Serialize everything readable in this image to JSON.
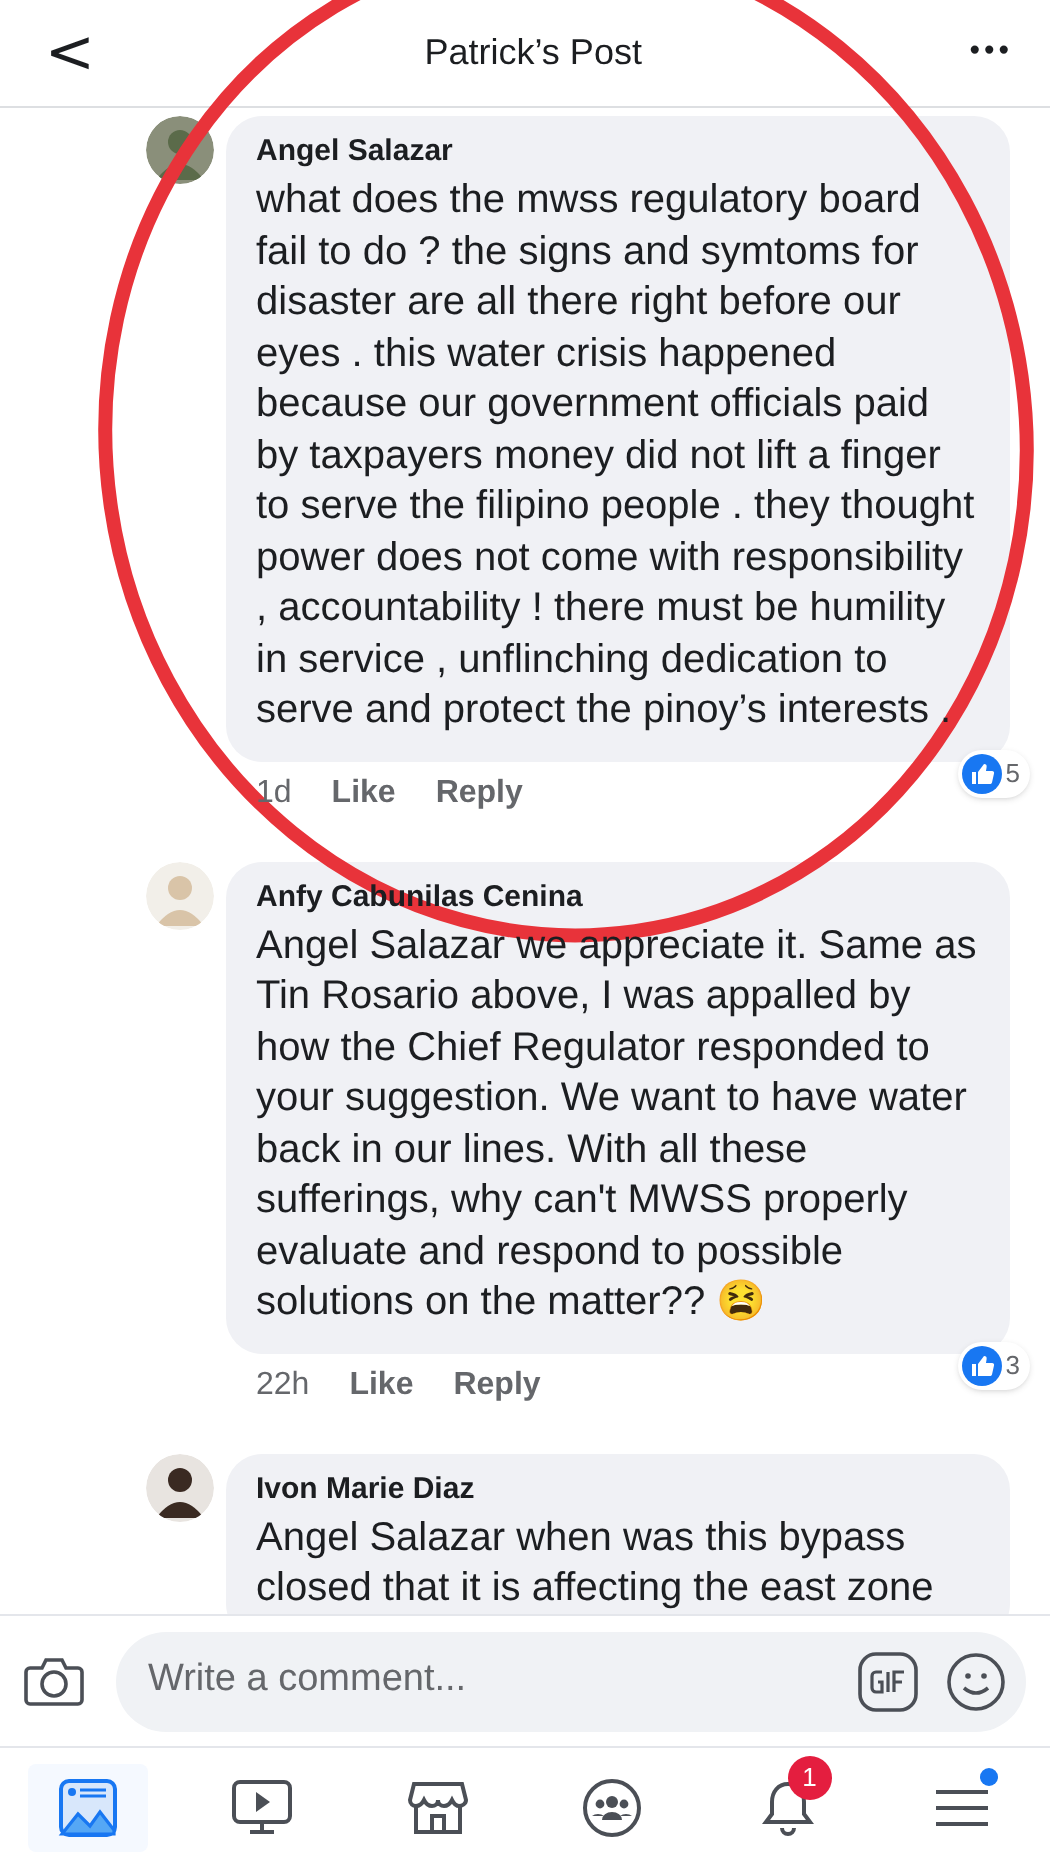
{
  "header": {
    "back": "<",
    "title": "Patrick’s Post",
    "more": "•••"
  },
  "comments": [
    {
      "author": "Angel Salazar",
      "text": "what does the mwss regulatory board fail to do ? the signs and symtoms for disaster are all there right before our eyes . this water crisis happened because our government officials paid by taxpayers money did not lift a finger to serve the filipino people . they thought power does not come with responsibility , accountability ! there must be humility in service , unflinching dedication to serve and protect the pinoy’s interests .",
      "time": "1d",
      "like": "Like",
      "reply": "Reply",
      "reactions": "5"
    },
    {
      "author": "Anfy Cabunilas Cenina",
      "text": "Angel Salazar we appreciate it. Same as Tin Rosario above, I was appalled by how the Chief Regulator responded to your suggestion. We want to have water back in our lines. With all these sufferings, why can't MWSS properly evaluate and respond to possible solutions on the matter?? 😫",
      "time": "22h",
      "like": "Like",
      "reply": "Reply",
      "reactions": "3"
    },
    {
      "author": "Ivon Marie Diaz",
      "text": "Angel Salazar when was this bypass closed that it is affecting the east zone"
    }
  ],
  "composer": {
    "placeholder": "Write a comment..."
  },
  "nav": [
    {
      "kind": "feed",
      "selected": true
    },
    {
      "kind": "video",
      "selected": false
    },
    {
      "kind": "market",
      "selected": false
    },
    {
      "kind": "groups",
      "selected": false
    },
    {
      "kind": "bell",
      "selected": false,
      "badge": "1"
    },
    {
      "kind": "menu",
      "selected": false,
      "dot": true
    }
  ]
}
